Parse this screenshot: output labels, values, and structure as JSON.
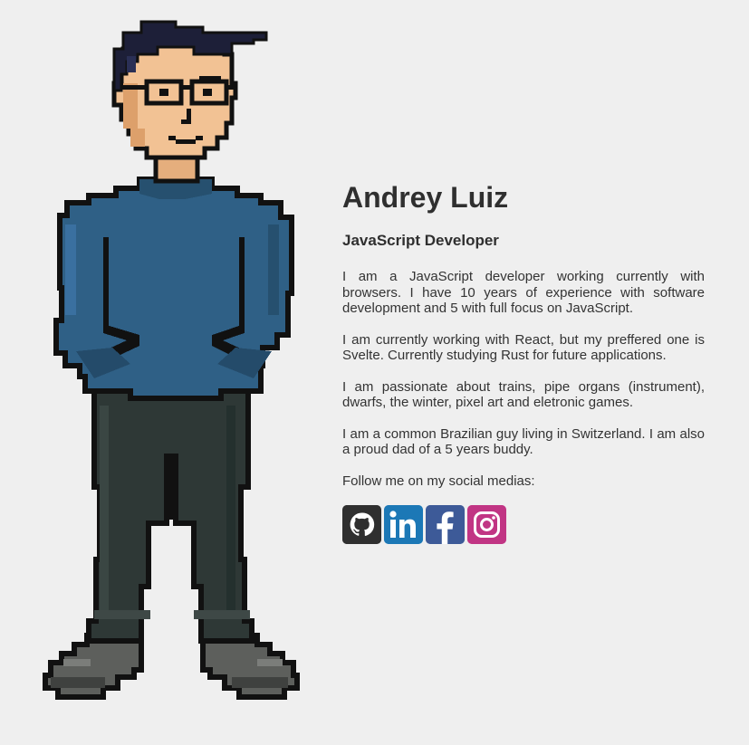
{
  "profile": {
    "name": "Andrey Luiz",
    "role": "JavaScript Developer",
    "bio": [
      "I am a JavaScript developer working currently with browsers. I have 10 years of experience with software development and 5 with full focus on JavaScript.",
      "I am currently working with React, but my preffered one is Svelte. Currently studying Rust for future applications.",
      "I am passionate about trains, pipe organs (instrument), dwarfs, the winter, pixel art and eletronic games.",
      "I am a common Brazilian guy living in Switzerland. I am also a proud dad of a 5 years buddy."
    ],
    "follow_text": "Follow me on my social medias:"
  },
  "socials": [
    {
      "icon": "github-icon",
      "color": "#2f2f2f"
    },
    {
      "icon": "linkedin-icon",
      "color": "#1c78b6"
    },
    {
      "icon": "facebook-icon",
      "color": "#3d5a98"
    },
    {
      "icon": "instagram-icon",
      "color": "#c13584"
    }
  ],
  "colors": {
    "background": "#efefef",
    "text": "#2f2f2f",
    "shirt": "#2f6086",
    "pants": "#2e3836",
    "shoes": "#5d5f5c",
    "skin": "#f2c294",
    "hair": "#1d1f38"
  }
}
